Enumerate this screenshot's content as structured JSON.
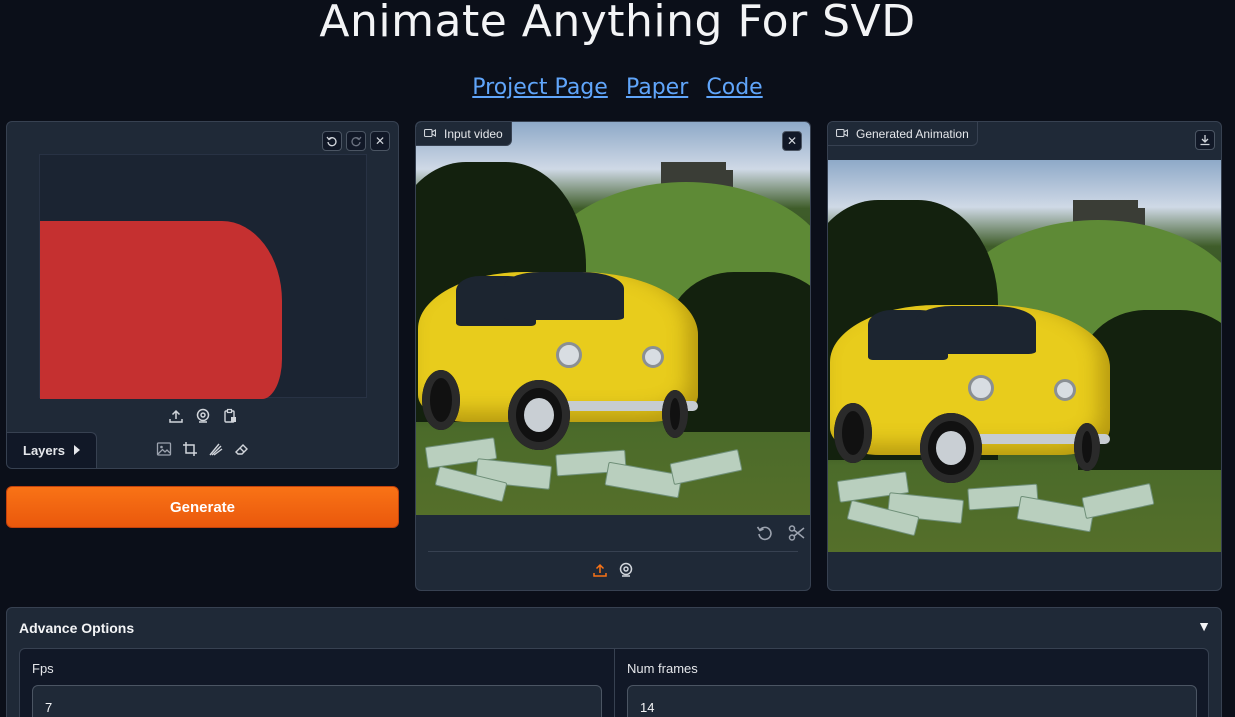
{
  "header": {
    "title": "Animate Anything For SVD",
    "links": [
      "Project Page",
      "Paper",
      "Code"
    ]
  },
  "editor": {
    "layers_label": "Layers",
    "layers_icon": "caret-right-icon",
    "top_tools": [
      "undo-icon",
      "redo-icon",
      "close-icon"
    ],
    "source_icons": [
      "upload-icon",
      "webcam-icon",
      "clipboard-icon"
    ],
    "tool_icons": [
      "image-icon",
      "crop-icon",
      "brush-icon",
      "eraser-icon"
    ],
    "mask_color": "#c53030"
  },
  "generate": {
    "label": "Generate",
    "color": "#f97316"
  },
  "input_video": {
    "label": "Input video",
    "controls": [
      "undo-icon",
      "scissors-icon"
    ],
    "sources": [
      "upload-icon",
      "webcam-icon"
    ]
  },
  "output": {
    "label": "Generated Animation",
    "actions": [
      "download-icon"
    ]
  },
  "advanced": {
    "title": "Advance Options",
    "fps_label": "Fps",
    "fps_value": "7",
    "frames_label": "Num frames",
    "frames_value": "14"
  }
}
